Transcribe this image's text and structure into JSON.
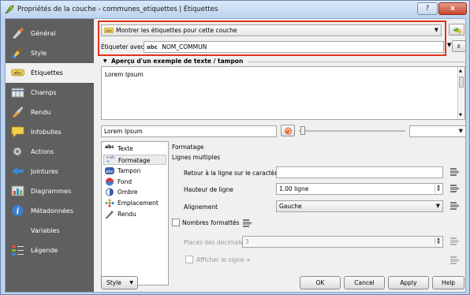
{
  "window": {
    "title": "Propriétés de la couche - communes_etiquettes | Étiquettes",
    "help_label": "?",
    "close_label": "x"
  },
  "sidebar": {
    "items": [
      {
        "label": "Général",
        "icon": "general-icon"
      },
      {
        "label": "Style",
        "icon": "style-icon"
      },
      {
        "label": "Étiquettes",
        "icon": "labels-icon",
        "active": true
      },
      {
        "label": "Champs",
        "icon": "fields-icon"
      },
      {
        "label": "Rendu",
        "icon": "rendering-icon"
      },
      {
        "label": "Infobulles",
        "icon": "tooltips-icon"
      },
      {
        "label": "Actions",
        "icon": "actions-icon"
      },
      {
        "label": "Jointures",
        "icon": "joins-icon"
      },
      {
        "label": "Diagrammes",
        "icon": "diagrams-icon"
      },
      {
        "label": "Métadonnées",
        "icon": "metadata-icon"
      },
      {
        "label": "Variables",
        "icon": "variables-icon"
      },
      {
        "label": "Légende",
        "icon": "legend-icon"
      }
    ]
  },
  "labels": {
    "mode_value": "Montrer les étiquettes pour cette couche",
    "label_with": "Étiqueter avec",
    "field_abc": "abc",
    "field_value": "NOM_COMMUN",
    "expression_button": "ε",
    "preview_title": "Aperçu d'un exemple de texte / tampon",
    "preview_text": "Lorem Ipsum",
    "sample_text_value": "Lorem Ipsum"
  },
  "tabs": [
    {
      "label": "Texte",
      "icon": "abc-text-icon"
    },
    {
      "label": "Formatage",
      "icon": "formatting-icon",
      "active": true
    },
    {
      "label": "Tampon",
      "icon": "buffer-icon"
    },
    {
      "label": "Fond",
      "icon": "background-icon"
    },
    {
      "label": "Ombre",
      "icon": "shadow-icon"
    },
    {
      "label": "Emplacement",
      "icon": "placement-icon"
    },
    {
      "label": "Rendu",
      "icon": "rendering-pen-icon"
    }
  ],
  "formatting": {
    "heading": "Formatage",
    "multiline_heading": "Lignes multiples",
    "wrap_label": "Retour à la ligne sur le caractère",
    "wrap_value": "",
    "line_height_label": "Hauteur de ligne",
    "line_height_value": "1.00 ligne",
    "alignment_label": "Alignement",
    "alignment_value": "Gauche",
    "formatted_numbers_label": "Nombres formattés",
    "decimal_places_label": "Places des décimales",
    "decimal_places_value": "3",
    "show_plus_label": "Afficher le signe +"
  },
  "footer": {
    "style_button": "Style",
    "ok": "OK",
    "cancel": "Cancel",
    "apply": "Apply",
    "help": "Help"
  },
  "colors": {
    "selection_frame": "#e2341d",
    "sidebar_bg": "#5f5f5f"
  }
}
